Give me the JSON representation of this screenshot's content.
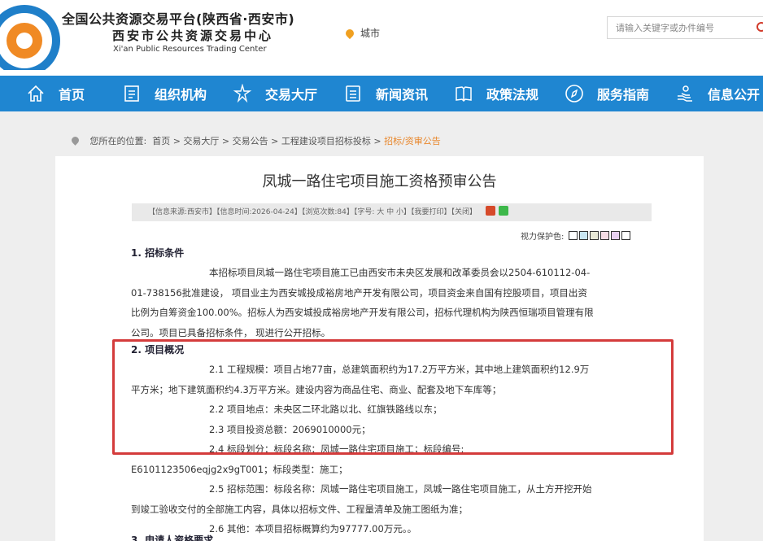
{
  "header": {
    "title_cn": "全国公共资源交易平台(陕西省·西安市)",
    "center_cn": "西安市公共资源交易中心",
    "center_en": "Xi'an Public Resources Trading Center",
    "city_label": "城市",
    "search_placeholder": "请输入关键字或办件编号"
  },
  "nav": {
    "items": [
      {
        "label": "首页",
        "icon": "home-icon"
      },
      {
        "label": "组织机构",
        "icon": "org-icon"
      },
      {
        "label": "交易大厅",
        "icon": "trade-hall-icon"
      },
      {
        "label": "新闻资讯",
        "icon": "news-icon"
      },
      {
        "label": "政策法规",
        "icon": "book-icon"
      },
      {
        "label": "服务指南",
        "icon": "compass-icon"
      },
      {
        "label": "信息公开",
        "icon": "info-icon"
      }
    ]
  },
  "breadcrumb": {
    "prefix": "您所在的位置:",
    "items": [
      "首页",
      "交易大厅",
      "交易公告",
      "工程建设项目招标投标"
    ],
    "current": "招标/资审公告"
  },
  "document": {
    "title": "凤城一路住宅项目施工资格预审公告",
    "info": "【信息来源:西安市】【信息时间:2026-04-24】【浏览次数:84】【字号: 大 中 小】【我要打印】【关闭】",
    "protect_label": "视力保护色:",
    "protect_colors": [
      "#ffffff",
      "#c9e6f2",
      "#e8e8d6",
      "#f5dce4",
      "#e8d0f0",
      "#ffffff"
    ],
    "s1_title": "1. 招标条件",
    "s1_lines": [
      "本招标项目凤城一路住宅项目施工已由西安市未央区发展和改革委员会以2504-610112-04-",
      "01-738156批准建设， 项目业主为西安城投成裕房地产开发有限公司，项目资金来自国有控股项目，项目出资",
      "比例为自筹资金100.00%。招标人为西安城投成裕房地产开发有限公司，招标代理机构为陕西恒瑞项目管理有限",
      "公司。项目已具备招标条件， 现进行公开招标。"
    ],
    "s2_title": "2. 项目概况",
    "s2_lines": [
      "2.1 工程规模：项目占地77亩，总建筑面积约为17.2万平方米，其中地上建筑面积约12.9万",
      "平方米；地下建筑面积约4.3万平方米。建设内容为商品住宅、商业、配套及地下车库等；",
      "2.2 项目地点：未央区二环北路以北、红旗铁路线以东；",
      "2.3 项目投资总额：2069010000元；",
      "2.4 标段划分：标段名称：凤城一路住宅项目施工；标段编号:",
      "E6101123506eqjg2x9gT001；标段类型：施工；",
      "2.5 招标范围：标段名称：凤城一路住宅项目施工，凤城一路住宅项目施工，从土方开挖开始",
      "到竣工验收交付的全部施工内容，具体以招标文件、工程量清单及施工图纸为准；",
      "2.6 其他：本项目招标概算约为97777.00万元。。"
    ],
    "s3_title": "3. 申请人资格要求"
  }
}
